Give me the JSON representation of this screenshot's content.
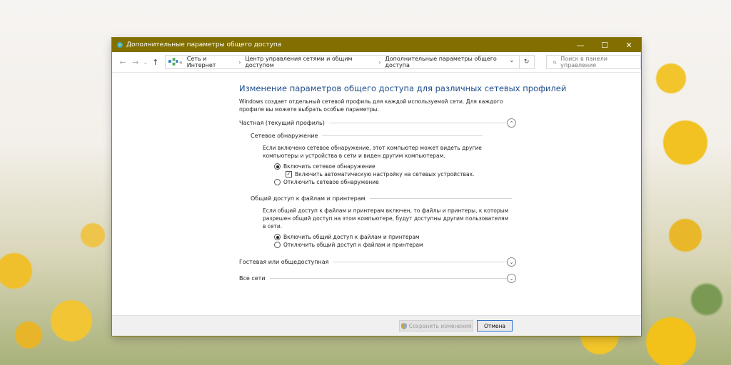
{
  "window": {
    "title": "Дополнительные параметры общего доступа",
    "controls": {
      "minimize": "—",
      "maximize": "☐",
      "close": "✕"
    }
  },
  "address_bar": {
    "back": "←",
    "forward": "→",
    "recent": "⌄",
    "up": "↑",
    "chevrons": "«",
    "breadcrumbs": [
      "Сеть и Интернет",
      "Центр управления сетями и общим доступом",
      "Дополнительные параметры общего доступа"
    ],
    "separator": "›",
    "dropdown": "⌄",
    "refresh": "↻"
  },
  "search": {
    "icon": "⌕",
    "placeholder": "Поиск в панели управления"
  },
  "main": {
    "heading": "Изменение параметров общего доступа для различных сетевых профилей",
    "intro": "Windows создает отдельный сетевой профиль для каждой используемой сети. Для каждого профиля вы можете выбрать особые параметры.",
    "profiles": [
      {
        "label": "Частная (текущий профиль)",
        "state": "expanded",
        "toggle": "⌃"
      },
      {
        "label": "Гостевая или общедоступная",
        "state": "collapsed",
        "toggle": "⌄"
      },
      {
        "label": "Все сети",
        "state": "collapsed",
        "toggle": "⌄"
      }
    ],
    "discovery": {
      "title": "Сетевое обнаружение",
      "description": "Если включено сетевое обнаружение, этот компьютер может видеть другие компьютеры и устройства в сети и виден другим компьютерам.",
      "on_label": "Включить сетевое обнаружение",
      "auto_label": "Включить автоматическую настройку на сетевых устройствах.",
      "off_label": "Отключить сетевое обнаружение",
      "selected": "on",
      "auto_checked": true
    },
    "sharing": {
      "title": "Общий доступ к файлам и принтерам",
      "description": "Если общий доступ к файлам и принтерам включен, то файлы и принтеры, к которым разрешен общий доступ на этом компьютере, будут доступны другим пользователям в сети.",
      "on_label": "Включить общий доступ к файлам и принтерам",
      "off_label": "Отключить общий доступ к файлам и принтерам",
      "selected": "on"
    }
  },
  "footer": {
    "save_label": "Сохранить изменения",
    "cancel_label": "Отмена"
  },
  "icons": {
    "app": "network-icon",
    "shield": "shield-icon",
    "check_glyph": "✓"
  },
  "colors": {
    "titlebar": "#826f00",
    "heading": "#1f4e8c",
    "focus": "#2b6fcf"
  }
}
